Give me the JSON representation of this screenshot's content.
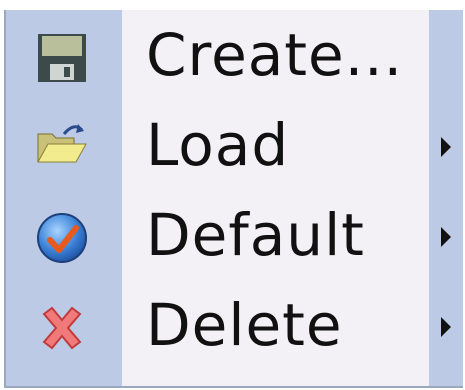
{
  "menu": {
    "items": [
      {
        "label": "Create...",
        "icon": "save-icon",
        "has_submenu": false
      },
      {
        "label": "Load",
        "icon": "open-folder-icon",
        "has_submenu": true
      },
      {
        "label": "Default",
        "icon": "checkmark-icon",
        "has_submenu": true
      },
      {
        "label": "Delete",
        "icon": "delete-x-icon",
        "has_submenu": true
      }
    ]
  },
  "colors": {
    "menu_background": "#f3f1f5",
    "gutter": "#bccae6",
    "text": "#111111"
  }
}
